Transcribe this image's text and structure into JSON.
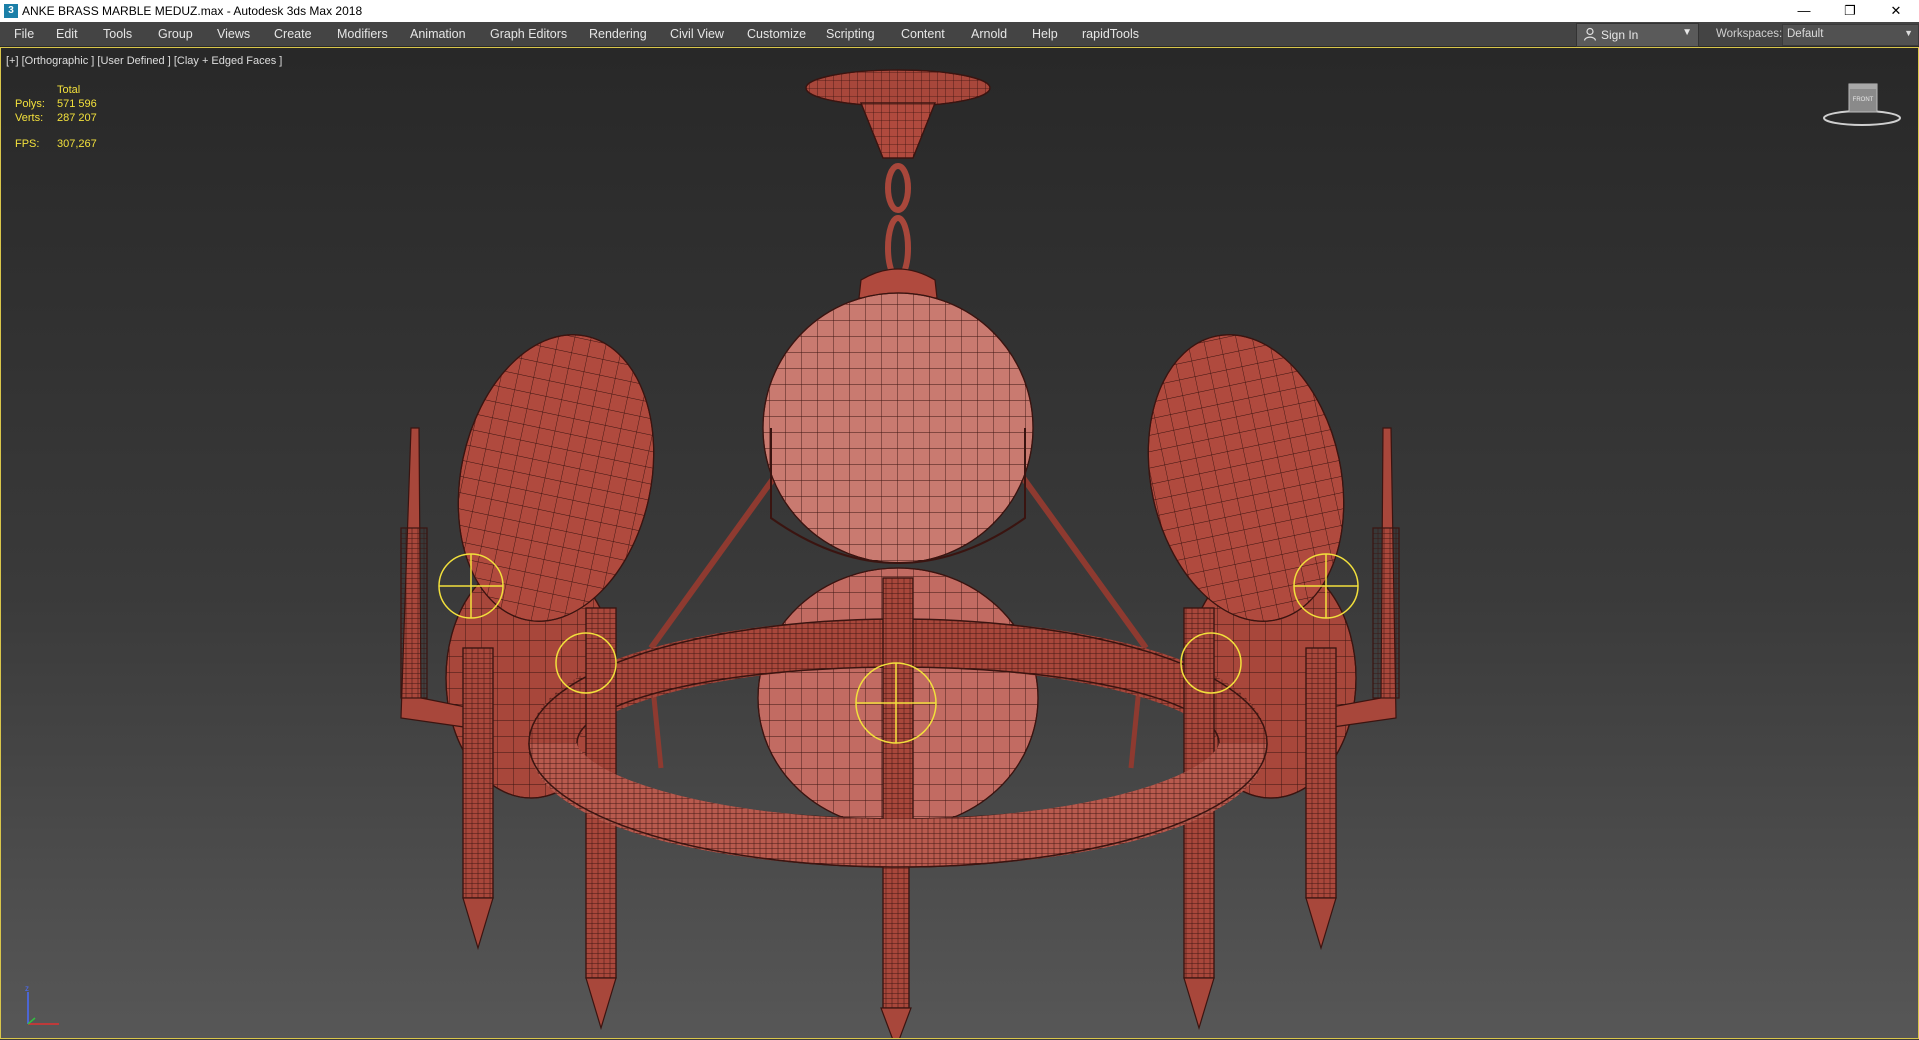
{
  "window": {
    "title": "ANKE BRASS MARBLE MEDUZ.max - Autodesk 3ds Max 2018",
    "minimize_glyph": "—",
    "maximize_glyph": "❐",
    "close_glyph": "✕"
  },
  "menu": [
    "File",
    "Edit",
    "Tools",
    "Group",
    "Views",
    "Create",
    "Modifiers",
    "Animation",
    "Graph Editors",
    "Rendering",
    "Civil View",
    "Customize",
    "Scripting",
    "Content",
    "Arnold",
    "Help",
    "rapidTools"
  ],
  "signin": {
    "label": "Sign In"
  },
  "workspaces": {
    "label": "Workspaces:",
    "value": "Default"
  },
  "viewport": {
    "label": "[+] [Orthographic ] [User Defined ] [Clay + Edged Faces ]",
    "stats": {
      "header": "Total",
      "polys_label": "Polys:",
      "polys_value": "571 596",
      "verts_label": "Verts:",
      "verts_value": "287 207",
      "fps_label": "FPS:",
      "fps_value": "307,267"
    },
    "viewcube_label": "FRONT"
  },
  "colors": {
    "model": "#b04a3e",
    "wire": "#3a1410",
    "selection": "#f2e03c",
    "viewport_border": "#d9c64a",
    "stats_text": "#f2e03c"
  }
}
